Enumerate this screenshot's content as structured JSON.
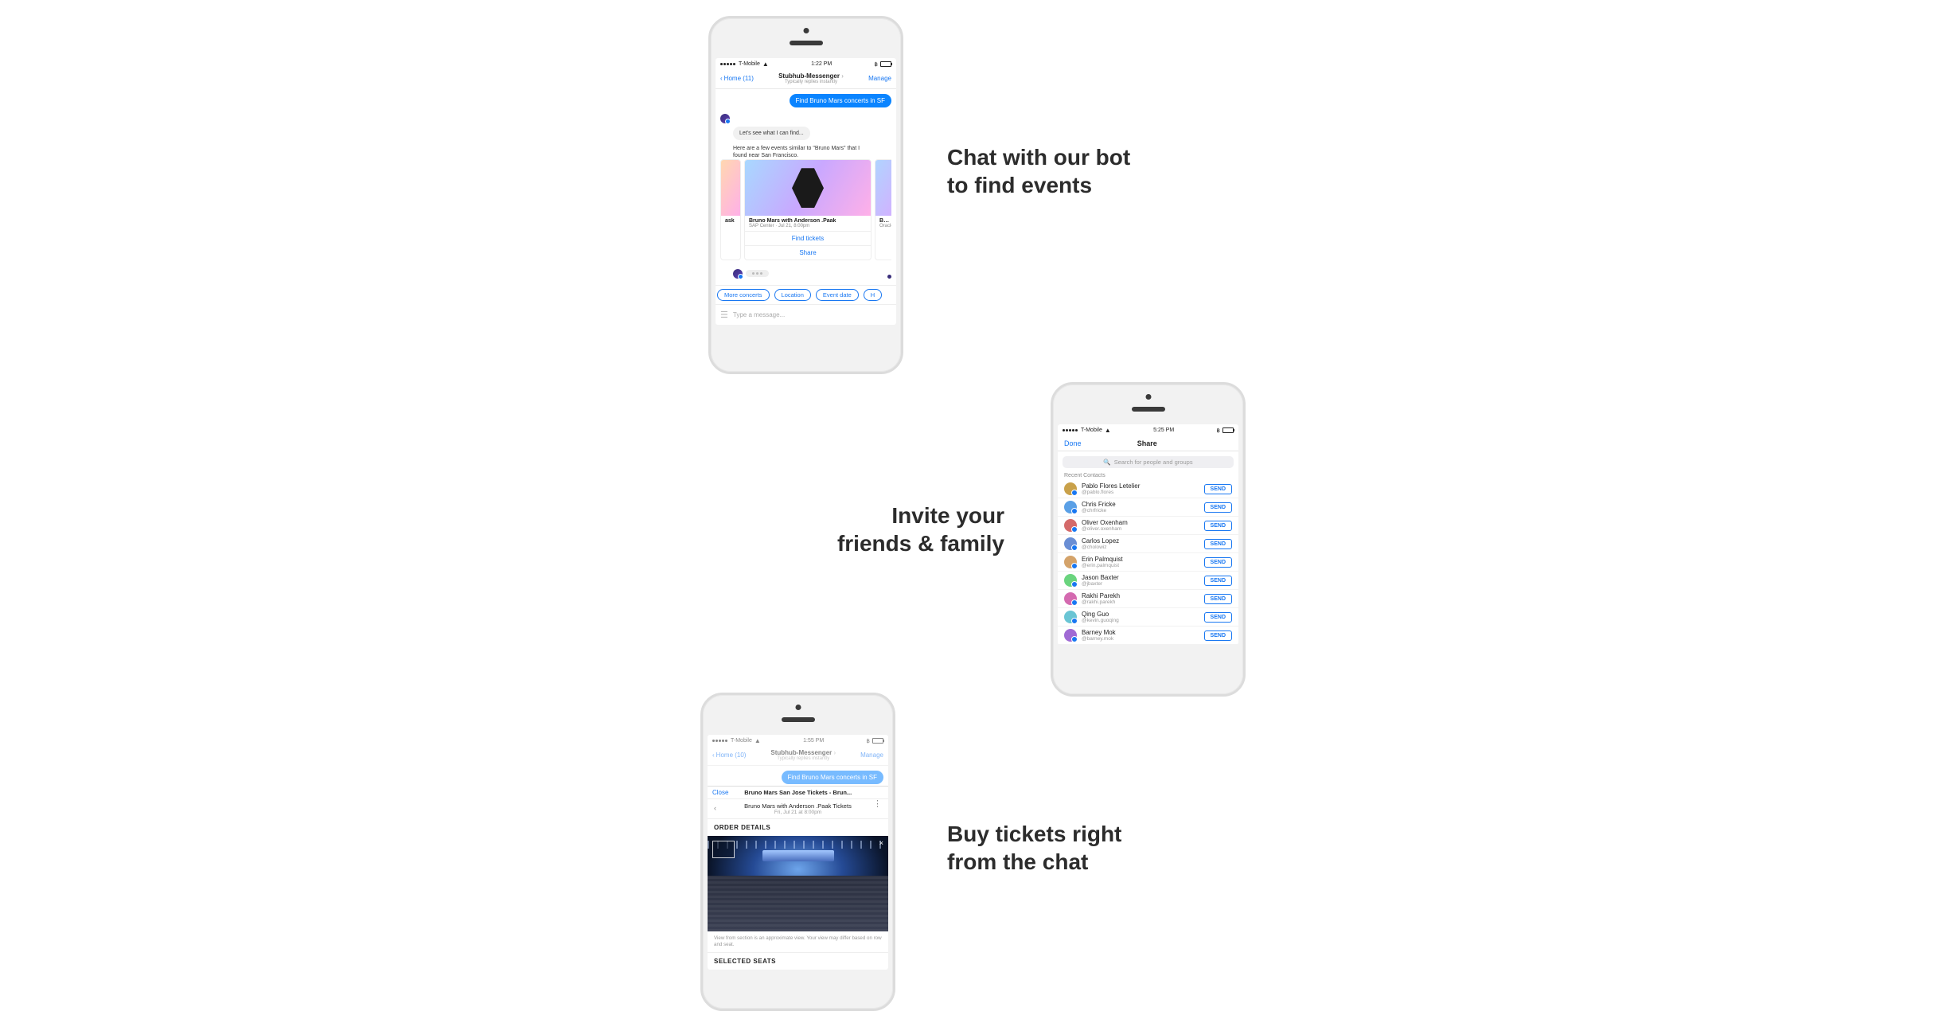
{
  "captions": {
    "chat": "Chat with our bot\nto find events",
    "invite": "Invite your\nfriends & family",
    "buy": "Buy tickets right\nfrom the chat"
  },
  "phone1": {
    "status": {
      "carrier": "T-Mobile",
      "time": "1:22 PM"
    },
    "nav": {
      "back": "Home (11)",
      "title": "Stubhub-Messenger",
      "subtitle": "Typically replies instantly",
      "manage": "Manage"
    },
    "user_msg": "Find Bruno Mars concerts in SF",
    "bot_msg1": "Let's see what I can find...",
    "bot_msg2": "Here are a few events similar to \"Bruno Mars\" that I found near San Francisco.",
    "card_side_left_title": "ask",
    "card_main": {
      "title": "Bruno Mars with Anderson .Paak",
      "subtitle": "SAP Center · Jul 21, 8:00pm",
      "btn1": "Find tickets",
      "btn2": "Share"
    },
    "card_side_right_title": "Bruno",
    "card_side_right_sub": "Oracle",
    "chips": [
      "More concerts",
      "Location",
      "Event date",
      "H"
    ],
    "composer": "Type a message..."
  },
  "phone2": {
    "status": {
      "carrier": "T-Mobile",
      "time": "5:25 PM"
    },
    "nav": {
      "done": "Done",
      "title": "Share"
    },
    "search": "Search for people and groups",
    "section": "Recent Contacts",
    "send": "SEND",
    "contacts": [
      {
        "name": "Pablo Flores Letelier",
        "handle": "@pablo.flores",
        "color": "#c9a14a"
      },
      {
        "name": "Chris Fricke",
        "handle": "@chrfricke",
        "color": "#5aa0e6"
      },
      {
        "name": "Oliver Oxenham",
        "handle": "@oliver.oxenham",
        "color": "#d46a6a"
      },
      {
        "name": "Carlos Lopez",
        "handle": "@cholowiz",
        "color": "#6a8ed4"
      },
      {
        "name": "Erin Palmquist",
        "handle": "@erin.palmquist",
        "color": "#d4a36a"
      },
      {
        "name": "Jason Baxter",
        "handle": "@jbaxter",
        "color": "#6ad47e"
      },
      {
        "name": "Rakhi Parekh",
        "handle": "@rakhi.parekh",
        "color": "#d46ab0"
      },
      {
        "name": "Qing Guo",
        "handle": "@kevin.guoqing",
        "color": "#6ac5d4"
      },
      {
        "name": "Barney Mok",
        "handle": "@barney.mok",
        "color": "#a06ad4"
      }
    ]
  },
  "phone3": {
    "status": {
      "carrier": "T-Mobile",
      "time": "1:55 PM"
    },
    "nav": {
      "back": "Home (10)",
      "title": "Stubhub-Messenger",
      "subtitle": "Typically replies instantly",
      "manage": "Manage"
    },
    "user_msg": "Find Bruno Mars concerts in SF",
    "webview": {
      "close": "Close",
      "title": "Bruno Mars San Jose Tickets - Brun..."
    },
    "event": {
      "title": "Bruno Mars with Anderson .Paak Tickets",
      "subtitle": "Fri, Jul 21 at 8:00pm"
    },
    "sec1": "ORDER DETAILS",
    "disclaimer": "View from section is an approximate view. Your view may differ based on row and seat.",
    "sec2": "SELECTED SEATS"
  }
}
